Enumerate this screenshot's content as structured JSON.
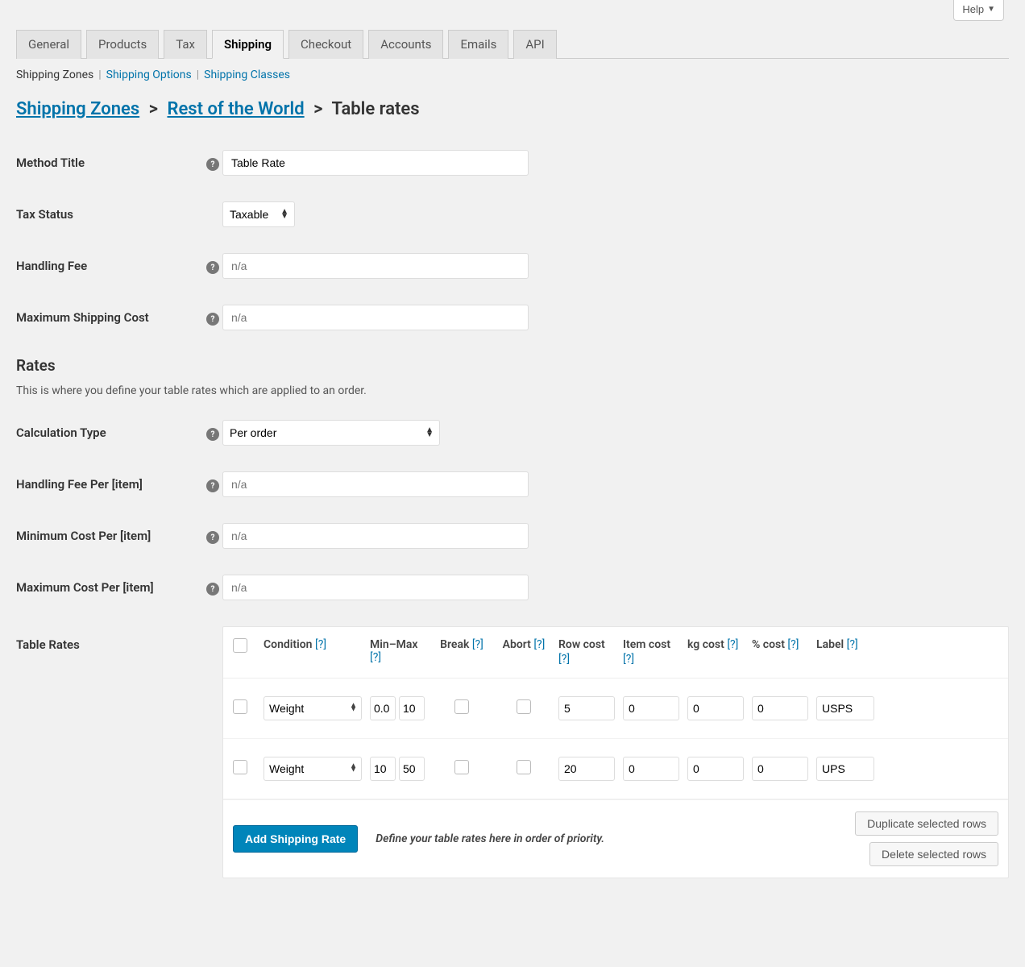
{
  "help_label": "Help",
  "tabs": [
    "General",
    "Products",
    "Tax",
    "Shipping",
    "Checkout",
    "Accounts",
    "Emails",
    "API"
  ],
  "active_tab_index": 3,
  "subnav": {
    "items": [
      "Shipping Zones",
      "Shipping Options",
      "Shipping Classes"
    ],
    "active_index": 0
  },
  "breadcrumb": {
    "zone_link": "Shipping Zones",
    "area_link": "Rest of the World",
    "tail": "Table rates"
  },
  "fields": {
    "method_title": {
      "label": "Method Title",
      "value": "Table Rate"
    },
    "tax_status": {
      "label": "Tax Status",
      "value": "Taxable"
    },
    "handling_fee": {
      "label": "Handling Fee",
      "value": "",
      "placeholder": "n/a"
    },
    "max_ship_cost": {
      "label": "Maximum Shipping Cost",
      "value": "",
      "placeholder": "n/a"
    },
    "calc_type": {
      "label": "Calculation Type",
      "value": "Per order"
    },
    "handling_fee_per": {
      "label": "Handling Fee Per [item]",
      "value": "",
      "placeholder": "n/a"
    },
    "min_cost_per": {
      "label": "Minimum Cost Per [item]",
      "value": "",
      "placeholder": "n/a"
    },
    "max_cost_per": {
      "label": "Maximum Cost Per [item]",
      "value": "",
      "placeholder": "n/a"
    }
  },
  "rates_section": {
    "title": "Rates",
    "subtitle": "This is where you define your table rates which are applied to an order.",
    "table_label": "Table Rates",
    "headers": {
      "condition": "Condition",
      "minmax": "Min–Max",
      "break": "Break",
      "abort": "Abort",
      "row_cost": "Row cost",
      "item_cost": "Item cost",
      "kg_cost": "kg cost",
      "pct_cost": "% cost",
      "label": "Label",
      "help": "[?]"
    },
    "rows": [
      {
        "condition": "Weight",
        "min": "0.0",
        "max": "10",
        "break": false,
        "abort": false,
        "row_cost": "5",
        "item_cost": "0",
        "kg_cost": "0",
        "pct_cost": "0",
        "label": "USPS"
      },
      {
        "condition": "Weight",
        "min": "10",
        "max": "50",
        "break": false,
        "abort": false,
        "row_cost": "20",
        "item_cost": "0",
        "kg_cost": "0",
        "pct_cost": "0",
        "label": "UPS"
      }
    ],
    "footer": {
      "add": "Add Shipping Rate",
      "hint": "Define your table rates here in order of priority.",
      "delete": "Delete selected rows",
      "duplicate": "Duplicate selected rows"
    }
  }
}
